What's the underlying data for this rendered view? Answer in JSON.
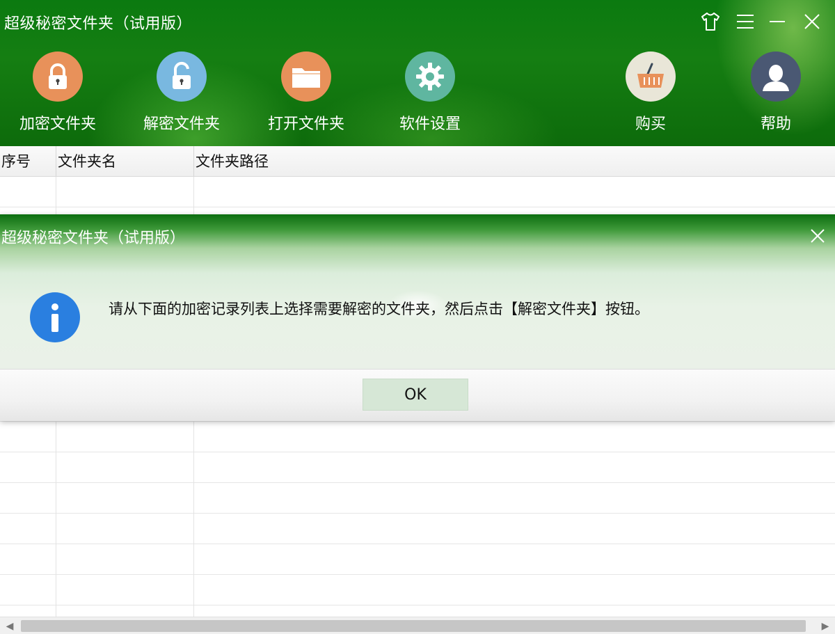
{
  "window": {
    "title": "超级秘密文件夹（试用版）"
  },
  "toolbar": {
    "items": [
      {
        "label": "加密文件夹",
        "icon": "lock-icon",
        "color": "#e8915a"
      },
      {
        "label": "解密文件夹",
        "icon": "unlock-icon",
        "color": "#79b8e0"
      },
      {
        "label": "打开文件夹",
        "icon": "folder-icon",
        "color": "#e8915a"
      },
      {
        "label": "软件设置",
        "icon": "gear-icon",
        "color": "#5fb6a0"
      },
      {
        "label": "购买",
        "icon": "basket-icon",
        "color": "#e9e6d8"
      },
      {
        "label": "帮助",
        "icon": "user-icon",
        "color": "#4a5873"
      }
    ]
  },
  "table": {
    "columns": [
      "序号",
      "文件夹名",
      "文件夹路径"
    ],
    "rows": []
  },
  "dialog": {
    "title": "超级秘密文件夹（试用版）",
    "message": "请从下面的加密记录列表上选择需要解密的文件夹，然后点击【解密文件夹】按钮。",
    "ok_label": "OK",
    "icon": "info-icon"
  },
  "colors": {
    "header_green": "#0b7a10",
    "info_blue": "#2a7fe0",
    "ok_button": "#d6e7d6"
  }
}
